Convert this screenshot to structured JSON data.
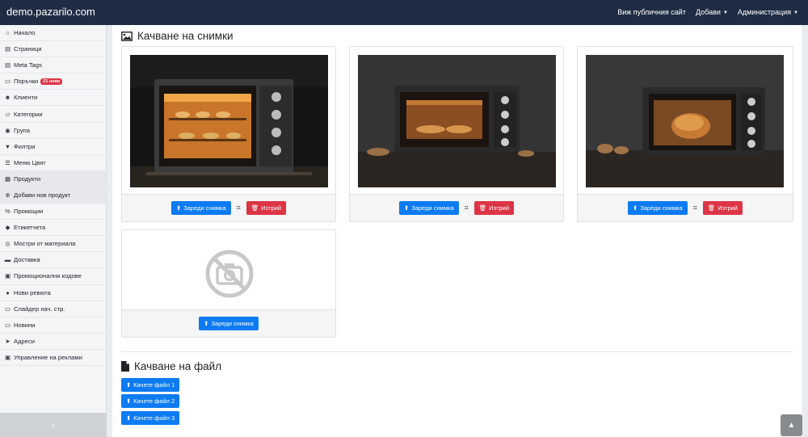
{
  "app": {
    "brand": "demo.pazarilo.com"
  },
  "topnav": {
    "public_site": "Виж публичния сайт",
    "add": "Добави",
    "admin": "Администрация"
  },
  "sidebar": {
    "items": [
      {
        "label": "Начало",
        "icon": "home-icon",
        "glyph": "⌂"
      },
      {
        "label": "Страници",
        "icon": "file-icon",
        "glyph": "▤"
      },
      {
        "label": "Meta Tags",
        "icon": "file-text-icon",
        "glyph": "▤"
      },
      {
        "label": "Поръчки",
        "icon": "cart-icon",
        "glyph": "▭",
        "badge": "21 нови"
      },
      {
        "label": "Клиенти",
        "icon": "users-icon",
        "glyph": "☻"
      },
      {
        "label": "Категории",
        "icon": "folder-open-icon",
        "glyph": "▱"
      },
      {
        "label": "Група",
        "icon": "group-icon",
        "glyph": "◉"
      },
      {
        "label": "Филтри",
        "icon": "filter-icon",
        "glyph": "▼"
      },
      {
        "label": "Меню Цвят",
        "icon": "menu-icon",
        "glyph": "☰"
      },
      {
        "label": "Продукти",
        "icon": "products-icon",
        "glyph": "▦"
      },
      {
        "label": "Добави нов продукт",
        "icon": "plus-circle-icon",
        "glyph": "⊕"
      },
      {
        "label": "Промоции",
        "icon": "percent-icon",
        "glyph": "%"
      },
      {
        "label": "Етикетчета",
        "icon": "tags-icon",
        "glyph": "◆"
      },
      {
        "label": "Мостри от материала",
        "icon": "dot-circle-icon",
        "glyph": "◎"
      },
      {
        "label": "Доставка",
        "icon": "truck-icon",
        "glyph": "▬"
      },
      {
        "label": "Промоционални кодове",
        "icon": "gift-icon",
        "glyph": "▣"
      },
      {
        "label": "Нови ревюта",
        "icon": "comments-icon",
        "glyph": "●"
      },
      {
        "label": "Слайдер нач. стр.",
        "icon": "slider-icon",
        "glyph": "▭"
      },
      {
        "label": "Новини",
        "icon": "newspaper-icon",
        "glyph": "▭"
      },
      {
        "label": "Адреси",
        "icon": "location-arrow-icon",
        "glyph": "➤"
      },
      {
        "label": "Управление на реклами",
        "icon": "ads-icon",
        "glyph": "▣"
      }
    ],
    "toggle_glyph": "‹"
  },
  "images": {
    "title": "Качване на снимки",
    "upload_label": "Зареди снимка",
    "delete_label": "Изтрий"
  },
  "files": {
    "title": "Качване на файл",
    "buttons": [
      "Качете файл 1",
      "Качете файл 2",
      "Качете файл 3"
    ]
  },
  "colors": {
    "navbar": "#1f2d44",
    "primary": "#0d7bf2",
    "danger": "#dc3545"
  }
}
